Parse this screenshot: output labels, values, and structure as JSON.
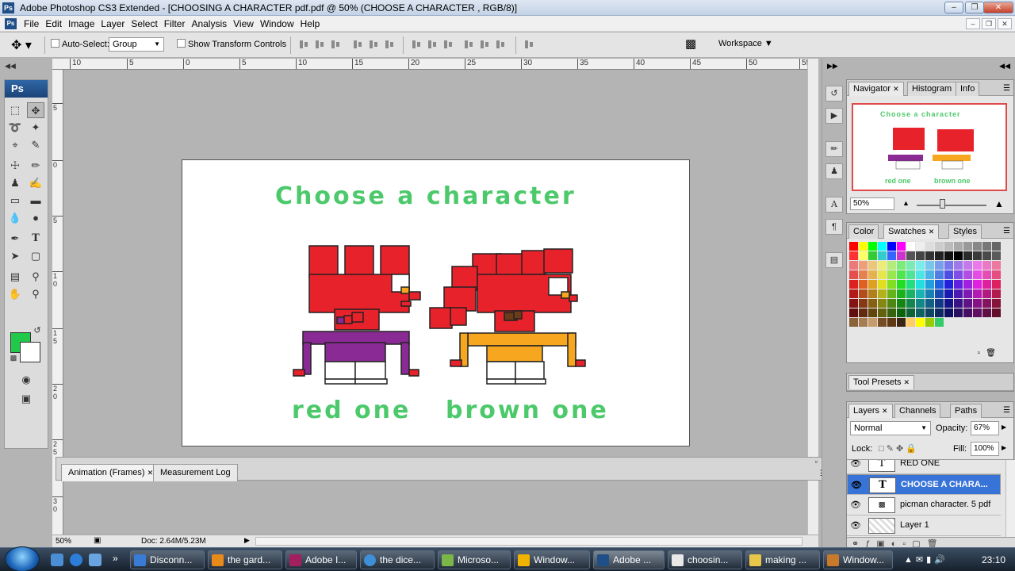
{
  "window": {
    "title": "Adobe Photoshop CS3 Extended - [CHOOSING A CHARACTER pdf.pdf @ 50% (CHOOSE A CHARACTER , RGB/8)]",
    "logo": "Ps"
  },
  "menu": {
    "items": [
      "File",
      "Edit",
      "Image",
      "Layer",
      "Select",
      "Filter",
      "Analysis",
      "View",
      "Window",
      "Help"
    ]
  },
  "options": {
    "auto_select_label": "Auto-Select:",
    "auto_select_value": "Group",
    "show_transform_label": "Show Transform Controls",
    "workspace_label": "Workspace"
  },
  "toolbox": {
    "header": "Ps",
    "foreground_color": "#21c94b",
    "background_color": "#ffffff"
  },
  "rulers": {
    "top": [
      "10",
      "5",
      "0",
      "5",
      "10",
      "15",
      "20",
      "25",
      "30",
      "35",
      "40",
      "45",
      "50",
      "55"
    ],
    "left": [
      "5",
      "0",
      "5",
      "1 0",
      "1 5",
      "2 0",
      "2 5",
      "3 0"
    ]
  },
  "canvas": {
    "headline": "Choose a character",
    "label_left": "red one",
    "label_right": "brown one",
    "accent_color": "#4cc96a"
  },
  "bottom_panel": {
    "tabs": [
      "Animation (Frames)",
      "Measurement Log"
    ]
  },
  "status": {
    "zoom": "50%",
    "doc": "Doc: 2.64M/5.23M"
  },
  "navigator": {
    "tabs": [
      "Navigator",
      "Histogram",
      "Info"
    ],
    "headline": "Choose a character",
    "label_left": "red one",
    "label_right": "brown one",
    "zoom": "50%"
  },
  "color_panel": {
    "tabs": [
      "Color",
      "Swatches",
      "Styles"
    ]
  },
  "tool_presets": {
    "tabs": [
      "Tool Presets"
    ]
  },
  "layers": {
    "tabs": [
      "Layers",
      "Channels",
      "Paths"
    ],
    "blend_mode": "Normal",
    "opacity_label": "Opacity:",
    "opacity_value": "67%",
    "lock_label": "Lock:",
    "fill_label": "Fill:",
    "fill_value": "100%",
    "rows": [
      {
        "name": "RED ONE",
        "type": "T"
      },
      {
        "name": "CHOOSE A CHARA...",
        "type": "T"
      },
      {
        "name": "picman character. 5  pdf",
        "type": "img"
      },
      {
        "name": "Layer 1",
        "type": "img"
      }
    ]
  },
  "taskbar": {
    "items": [
      "Disconn...",
      "the gard...",
      "Adobe I...",
      "the dice...",
      "Microso...",
      "Window...",
      "Adobe ...",
      "choosin...",
      "making ...",
      "Window..."
    ],
    "clock": "23:10"
  }
}
